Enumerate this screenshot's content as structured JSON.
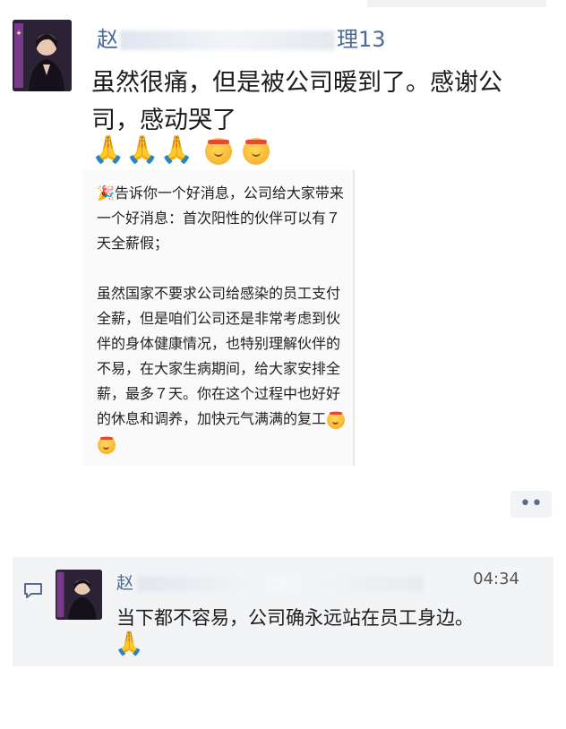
{
  "post": {
    "author_prefix": "赵",
    "author_suffix": "理13",
    "main_text": "虽然很痛，但是被公司暖到了。感谢公司，感动哭了",
    "emoji_row": "🙏🙏🙏",
    "emoji_faces": [
      "salute-face",
      "salute-face"
    ],
    "forward_text": "🎉告诉你一个好消息，公司给大家带来一个好消息：首次阳性的伙伴可以有７天全薪假；\n\n虽然国家不要求公司给感染的员工支付全薪，但是咱们公司还是非常考虑到伙伴的身体健康情况，也特别理解伙伴的不易，在大家生病期间，给大家安排全薪，最多７天。你在这个过程中也好好的休息和调养，加快元气满满的复工",
    "forward_emoji": [
      "salute-face",
      "salute-face"
    ],
    "more_label": "••"
  },
  "comment": {
    "author_prefix": "赵",
    "time": "04:34",
    "text": "当下都不容易，公司确永远站在员工身边。",
    "emoji": "🙏",
    "icon": "comment-icon"
  },
  "colors": {
    "name_blue": "#4a6a9a",
    "comment_bg": "#f3f4f6"
  }
}
